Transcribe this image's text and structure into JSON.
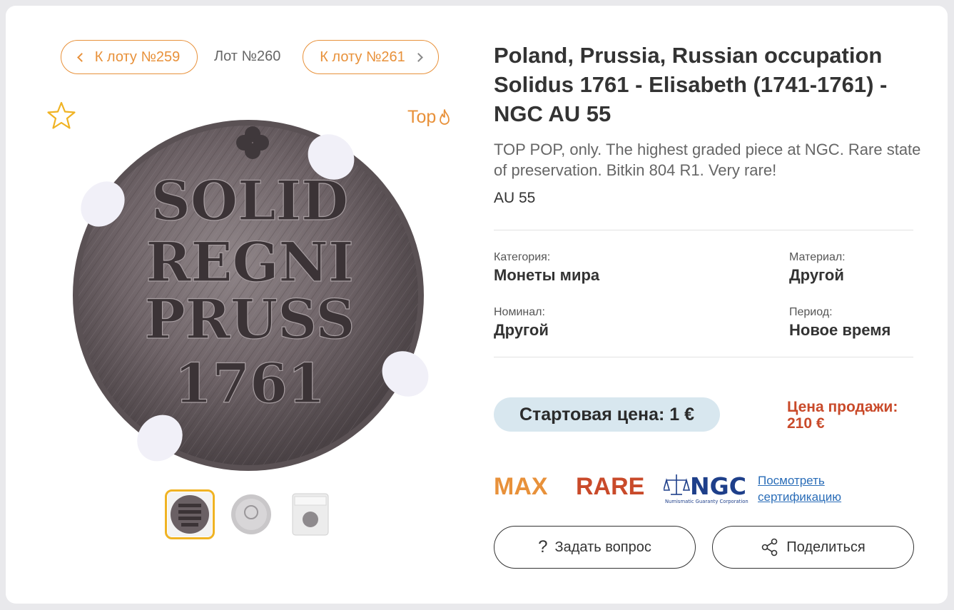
{
  "nav": {
    "prev_label": "К лоту №259",
    "current_label": "Лот №260",
    "next_label": "К лоту №261"
  },
  "badge": {
    "top_label": "Top"
  },
  "lot": {
    "title": "Poland, Prussia, Russian occupation Solidus 1761 - Elisabeth (1741-1761) - NGC AU 55",
    "description": "TOP POP, only. The highest graded piece at NGC. Rare state of preservation. Bitkin 804 R1. Very rare!",
    "grade": "AU 55"
  },
  "properties": {
    "category_label": "Категория:",
    "category_value": "Монеты мира",
    "material_label": "Материал:",
    "material_value": "Другой",
    "nominal_label": "Номинал:",
    "nominal_value": "Другой",
    "period_label": "Период:",
    "period_value": "Новое время"
  },
  "price": {
    "start_label": "Стартовая цена: 1 €",
    "sold_label": "Цена продажи:",
    "sold_value": "210 €"
  },
  "tags": {
    "max": "MAX",
    "rare": "RARE"
  },
  "ngc": {
    "logo_text": "NGC",
    "logo_subtext": "Numismatic Guaranty Corporation",
    "link_line1": "Посмотреть",
    "link_line2": "сертификацию"
  },
  "actions": {
    "ask_label": "Задать вопрос",
    "share_label": "Поделиться"
  },
  "coin": {
    "legend_lines": [
      "SOLID",
      "REGNI",
      "PRUSS",
      "1761"
    ]
  },
  "thumbnails": {
    "count": 3,
    "active_index": 0
  },
  "colors": {
    "accent": "#e8913a",
    "sold_red": "#c94a2a",
    "start_price_bg": "#d8e7ef",
    "active_thumb_border": "#f0b323",
    "link": "#2a6db8"
  }
}
